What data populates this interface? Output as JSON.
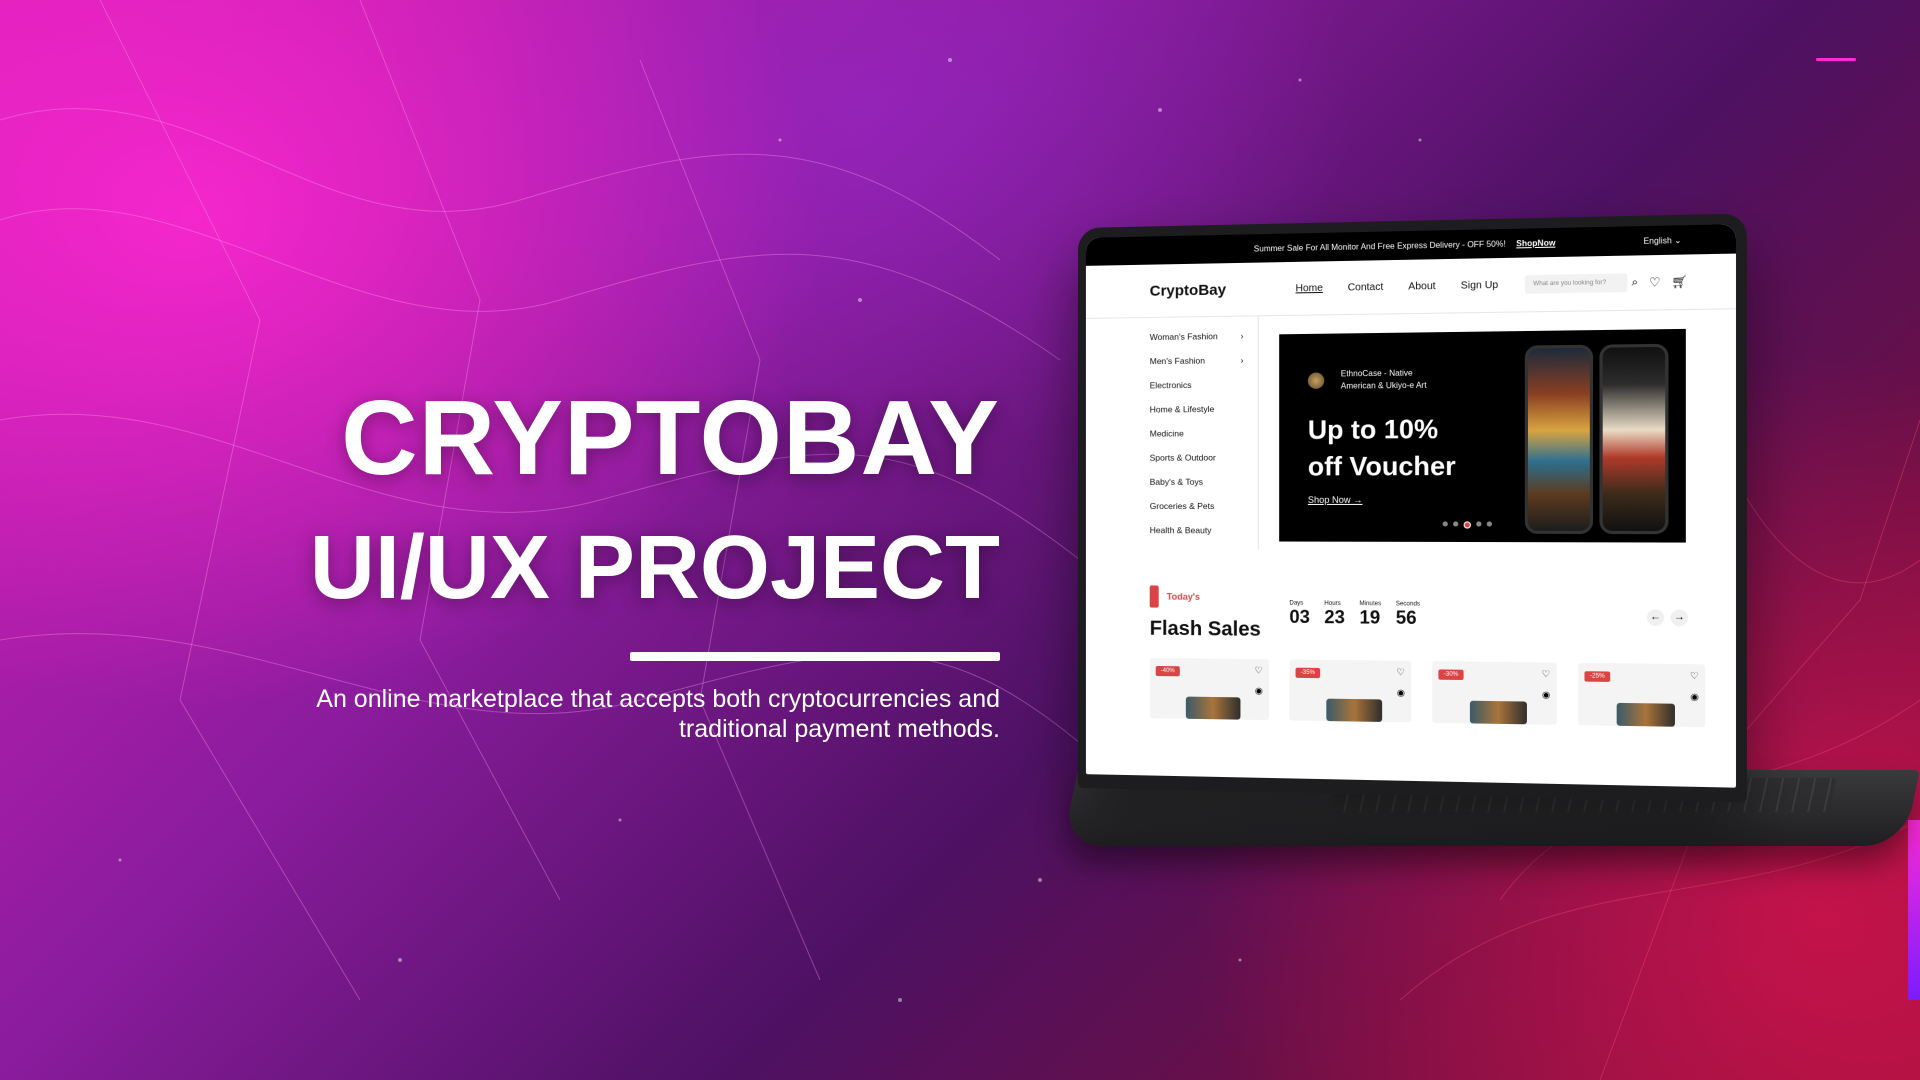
{
  "hero": {
    "title_line1": "CRYPTOBAY",
    "title_line2": "UI/UX PROJECT",
    "description": "An online marketplace that accepts both cryptocurrencies and traditional payment methods."
  },
  "site": {
    "topbar": {
      "text": "Summer Sale For All Monitor And Free Express Delivery - OFF 50%!",
      "shop_now": "ShopNow",
      "language": "English"
    },
    "logo": "CryptoBay",
    "nav": [
      "Home",
      "Contact",
      "About",
      "Sign Up"
    ],
    "search_placeholder": "What are you looking for?",
    "categories": [
      {
        "label": "Woman's Fashion",
        "chevron": true
      },
      {
        "label": "Men's Fashion",
        "chevron": true
      },
      {
        "label": "Electronics",
        "chevron": false
      },
      {
        "label": "Home & Lifestyle",
        "chevron": false
      },
      {
        "label": "Medicine",
        "chevron": false
      },
      {
        "label": "Sports & Outdoor",
        "chevron": false
      },
      {
        "label": "Baby's & Toys",
        "chevron": false
      },
      {
        "label": "Groceries & Pets",
        "chevron": false
      },
      {
        "label": "Health & Beauty",
        "chevron": false
      }
    ],
    "banner": {
      "brand": "EthnoCase - Native American & Ukiyo-e Art",
      "headline_1": "Up to 10%",
      "headline_2": "off Voucher",
      "cta": "Shop Now"
    },
    "flash": {
      "label": "Today's",
      "title": "Flash Sales",
      "timer": [
        {
          "label": "Days",
          "value": "03"
        },
        {
          "label": "Hours",
          "value": "23"
        },
        {
          "label": "Minutes",
          "value": "19"
        },
        {
          "label": "Seconds",
          "value": "56"
        }
      ],
      "cards": [
        {
          "discount": "-40%"
        },
        {
          "discount": "-35%"
        },
        {
          "discount": "-30%"
        },
        {
          "discount": "-25%"
        }
      ]
    }
  },
  "colors": {
    "accent": "#db4444",
    "background_pink": "#d61fb6",
    "background_red": "#8f1038"
  }
}
